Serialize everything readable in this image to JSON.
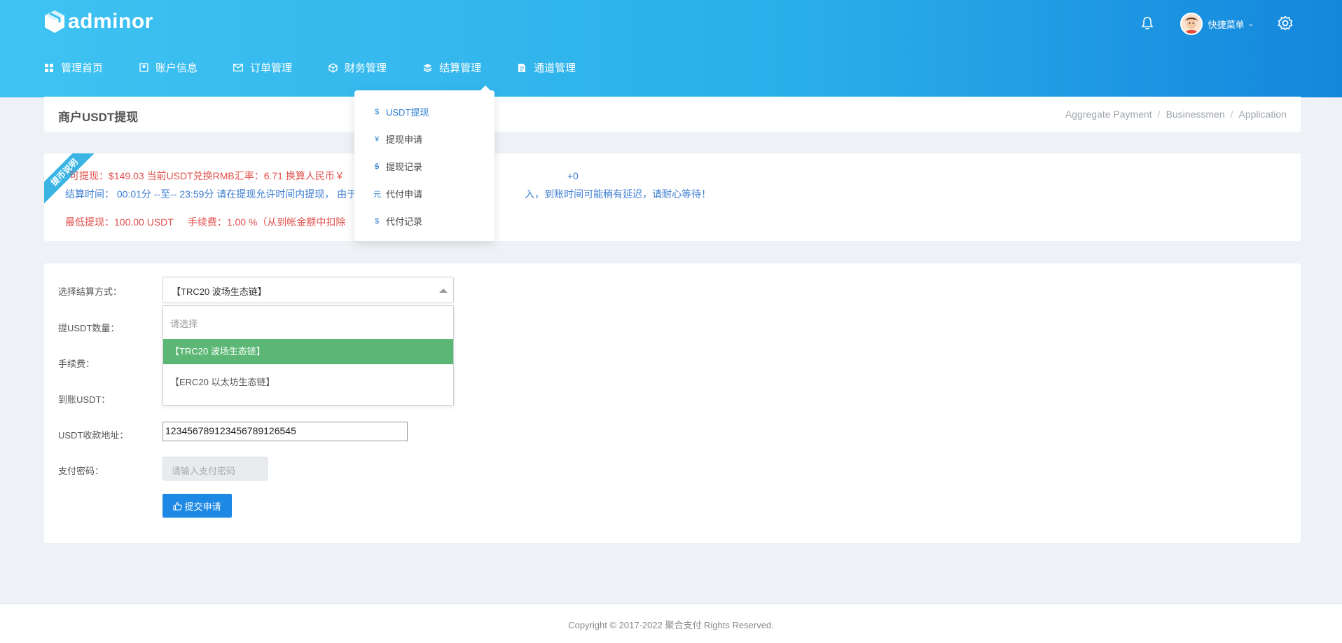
{
  "brand": {
    "name": "adminor",
    "accent": "#2aaee9",
    "success": "#5cb775",
    "primary": "#1e88e5"
  },
  "nav": [
    {
      "label": "管理首页",
      "icon": "grid-icon"
    },
    {
      "label": "账户信息",
      "icon": "user-icon"
    },
    {
      "label": "订单管理",
      "icon": "envelope-icon"
    },
    {
      "label": "财务管理",
      "icon": "cube-icon"
    },
    {
      "label": "结算管理",
      "icon": "layers-icon"
    },
    {
      "label": "通道管理",
      "icon": "file-icon"
    }
  ],
  "header": {
    "quick_menu": "快捷菜单"
  },
  "settle_menu": [
    {
      "label": "USDT提现",
      "icon": "dollar-icon",
      "glyph": "$"
    },
    {
      "label": "提现申请",
      "icon": "yen-icon",
      "glyph": "¥"
    },
    {
      "label": "提现记录",
      "icon": "no-dollar-icon",
      "glyph": "$"
    },
    {
      "label": "代付申请",
      "icon": "currency-icon",
      "glyph": "元"
    },
    {
      "label": "代付记录",
      "icon": "dollar-icon",
      "glyph": "$"
    }
  ],
  "page": {
    "title": "商户USDT提现",
    "breadcrumbs": [
      "Aggregate Payment",
      "Businessmen",
      "Application"
    ]
  },
  "notice": {
    "ribbon": "提币说明",
    "line1_red": "可提现：$149.03  当前USDT兑换RMB汇率：6.71  换算人民币￥",
    "line1_blue": "+0",
    "line2": "结算时间：  00:01分 --至-- 23:59分 请在提现允许时间内提现，  由于",
    "line2_tail": "入，到账时间可能稍有延迟，请耐心等待！",
    "line3_min": "最低提现：100.00 USDT",
    "line3_fee": "手续费：1.00 %（从到帐金额中扣除"
  },
  "form": {
    "labels": {
      "method": "选择结算方式：",
      "amount": "提USDT数量：",
      "fee": "手续费：",
      "received": "到账USDT：",
      "address": "USDT收款地址：",
      "password": "支付密码："
    },
    "method_selected": "【TRC20 波场生态链】",
    "dropdown_placeholder": "请选择",
    "options": [
      "【TRC20 波场生态链】",
      "【ERC20 以太坊生态链】"
    ],
    "address_value": "1234567891234567891​26545",
    "password_placeholder": "请输入支付密码",
    "submit_label": "提交申请"
  },
  "footer": {
    "copyright": "Copyright © 2017-2022 聚合支付 Rights Reserved."
  }
}
